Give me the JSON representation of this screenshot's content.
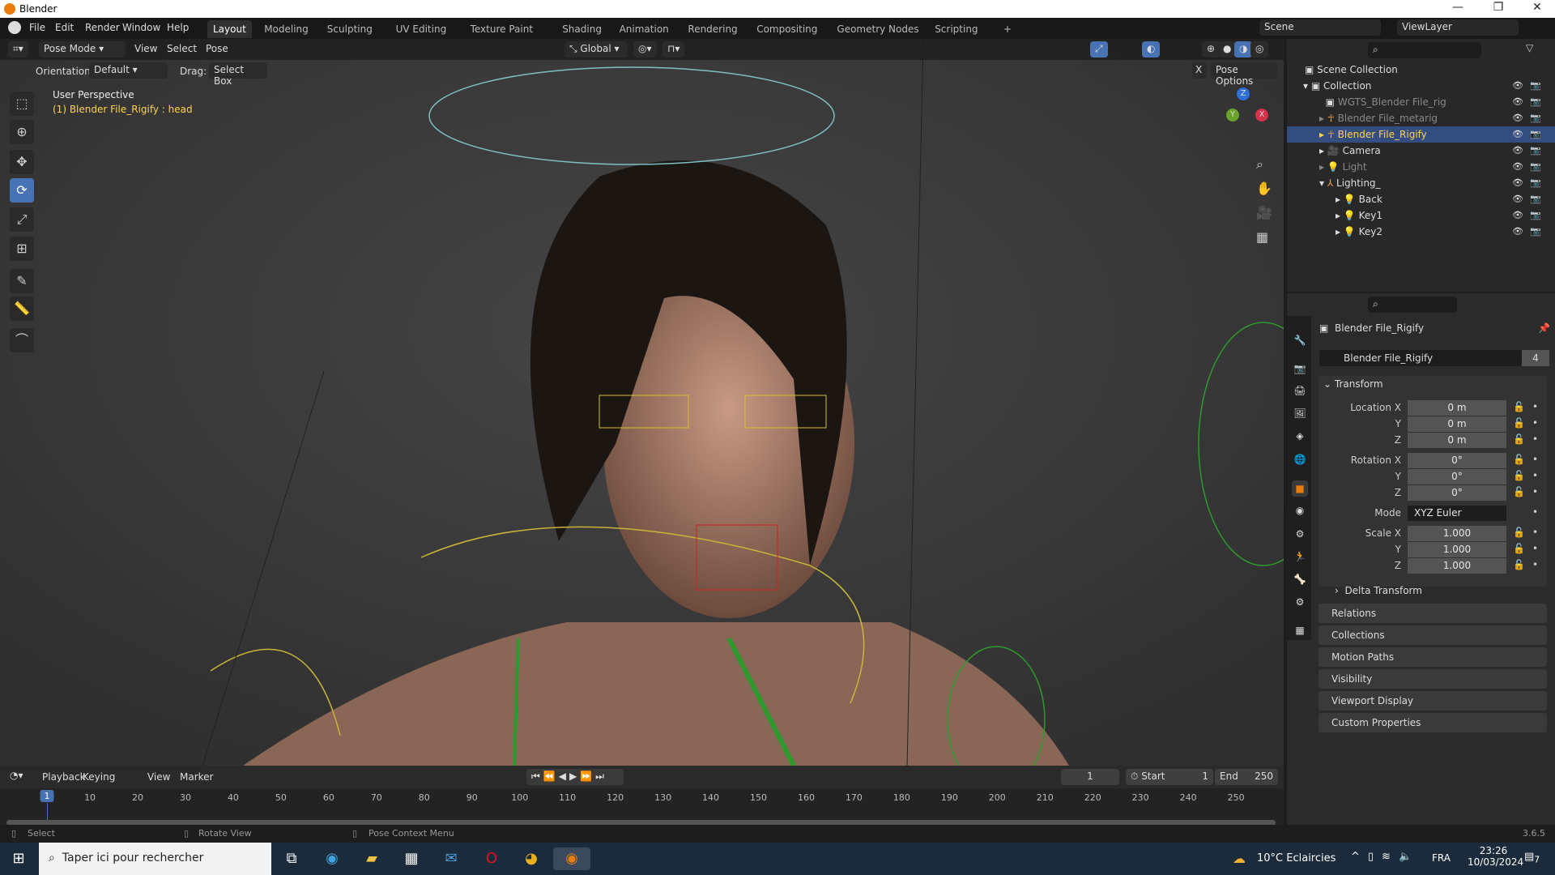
{
  "window": {
    "title": "Blender",
    "minimize": "—",
    "restore": "❐",
    "close": "✕"
  },
  "topbar": {
    "menus": [
      "File",
      "Edit",
      "Render",
      "Window",
      "Help"
    ],
    "workspaces": [
      "Layout",
      "Modeling",
      "Sculpting",
      "UV Editing",
      "Texture Paint",
      "Shading",
      "Animation",
      "Rendering",
      "Compositing",
      "Geometry Nodes",
      "Scripting"
    ],
    "add": "+",
    "scene": "Scene",
    "view_layer": "ViewLayer"
  },
  "viewport": {
    "mode": "Pose Mode",
    "menus": [
      "View",
      "Select",
      "Pose"
    ],
    "transform_orientation": "Global",
    "orientation_label": "Orientation:",
    "orientation_value": "Default",
    "drag_label": "Drag:",
    "drag_value": "Select Box",
    "pose_options": "Pose Options",
    "x_mirror": "X",
    "perspective": "User Perspective",
    "active": "(1) Blender File_Rigify : head",
    "gizmo": {
      "x": "X",
      "y": "Y",
      "z": "Z"
    }
  },
  "tools": [
    "select-box",
    "cursor",
    "move",
    "rotate",
    "scale",
    "transform",
    "annotate",
    "measure",
    "relax"
  ],
  "outliner": {
    "root": "Scene Collection",
    "rows": [
      {
        "label": "Collection",
        "indent": 1,
        "icon": "collection",
        "expand": "▾",
        "dim": false
      },
      {
        "label": "WGTS_Blender File_rig",
        "indent": 2,
        "icon": "collection",
        "expand": "",
        "dim": true
      },
      {
        "label": "Blender File_metarig",
        "indent": 2,
        "icon": "armature",
        "expand": "▸",
        "dim": true
      },
      {
        "label": "Blender File_Rigify",
        "indent": 2,
        "icon": "armature",
        "expand": "▸",
        "dim": false,
        "selected": true
      },
      {
        "label": "Camera",
        "indent": 2,
        "icon": "camera",
        "expand": "▸",
        "dim": false
      },
      {
        "label": "Light",
        "indent": 2,
        "icon": "light",
        "expand": "▸",
        "dim": true
      },
      {
        "label": "Lighting_",
        "indent": 2,
        "icon": "empty",
        "expand": "▾",
        "dim": false
      },
      {
        "label": "Back",
        "indent": 3,
        "icon": "light",
        "expand": "▸",
        "dim": false
      },
      {
        "label": "Key1",
        "indent": 3,
        "icon": "light",
        "expand": "▸",
        "dim": false
      },
      {
        "label": "Key2",
        "indent": 3,
        "icon": "light",
        "expand": "▸",
        "dim": false
      }
    ]
  },
  "properties": {
    "object_name": "Blender File_Rigify",
    "datablock": "Blender File_Rigify",
    "users": "4",
    "transform_header": "Transform",
    "rows": [
      {
        "label": "Location X",
        "value": "0 m"
      },
      {
        "label": "Y",
        "value": "0 m"
      },
      {
        "label": "Z",
        "value": "0 m"
      },
      {
        "label": "Rotation X",
        "value": "0°"
      },
      {
        "label": "Y",
        "value": "0°"
      },
      {
        "label": "Z",
        "value": "0°"
      },
      {
        "label": "Mode",
        "value": "XYZ Euler"
      },
      {
        "label": "Scale X",
        "value": "1.000"
      },
      {
        "label": "Y",
        "value": "1.000"
      },
      {
        "label": "Z",
        "value": "1.000"
      }
    ],
    "subpanel": "Delta Transform",
    "panels": [
      "Relations",
      "Collections",
      "Motion Paths",
      "Visibility",
      "Viewport Display",
      "Custom Properties"
    ]
  },
  "timeline": {
    "menus": [
      "Playback",
      "Keying",
      "View",
      "Marker"
    ],
    "current_frame": "1",
    "start_label": "Start",
    "start": "1",
    "end_label": "End",
    "end": "250",
    "ticks": [
      "1",
      "10",
      "20",
      "30",
      "40",
      "50",
      "60",
      "70",
      "80",
      "90",
      "100",
      "110",
      "120",
      "130",
      "140",
      "150",
      "160",
      "170",
      "180",
      "190",
      "200",
      "210",
      "220",
      "230",
      "240",
      "250"
    ]
  },
  "statusbar": {
    "left": "Select",
    "middle": "Rotate View",
    "right": "Pose Context Menu",
    "version": "3.6.5"
  },
  "taskbar": {
    "search": "Taper ici pour rechercher",
    "weather": "10°C  Eclaircies",
    "lang": "FRA",
    "time": "23:26",
    "date": "10/03/2024",
    "notifications": "7"
  },
  "colors": {
    "accent": "#4772b3",
    "selected_row": "#334d80",
    "active_text": "#ffd24d",
    "orange": "#e87d0d"
  }
}
